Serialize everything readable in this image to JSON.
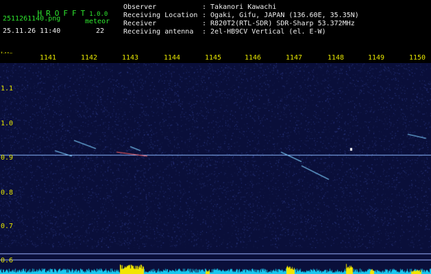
{
  "header": {
    "logo": "HROFFT",
    "version": "1.0.0",
    "filename": "2511261140.png",
    "datetime": "25.11.26 11:40",
    "meteor_label": "meteor",
    "meteor_count": "22",
    "fields": [
      {
        "label": "Observer",
        "value": ": Takanori Kawachi"
      },
      {
        "label": "Receiving Location",
        "value": ": Ogaki, Gifu, JAPAN (136.60E, 35.35N)"
      },
      {
        "label": "Receiver",
        "value": ": R820T2(RTL-SDR) SDR-Sharp 53.372MHz"
      },
      {
        "label": "Receiving antenna",
        "value": ": 2el-HB9CV Vertical (el. E-W)"
      }
    ]
  },
  "axis": {
    "unit": "kHz",
    "minute_ticks": [
      "1141",
      "1142",
      "1143",
      "1144",
      "1145",
      "1146",
      "1147",
      "1148",
      "1149",
      "1150"
    ],
    "freq_ticks": [
      "1.1",
      "1.0",
      "0.9",
      "0.8",
      "0.7",
      "0.6"
    ]
  },
  "colors": {
    "background": "#0a0f3a",
    "header_text": "#2ee62e",
    "axis_text": "#e6e600",
    "carrier": "#8ab8ff",
    "activity_bar": "#19c8f0",
    "activity_peak": "#f2e600"
  }
}
